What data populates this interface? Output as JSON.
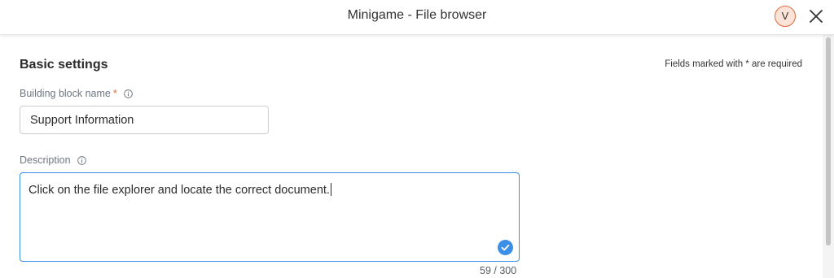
{
  "header": {
    "title": "Minigame - File browser",
    "avatar_initial": "V",
    "close_icon": "close-icon",
    "avatar_border_color": "#e0693d"
  },
  "section": {
    "title": "Basic settings",
    "required_note": "Fields marked with * are required"
  },
  "fields": {
    "name": {
      "label": "Building block name",
      "required_mark": "*",
      "info_icon": "info-icon",
      "value": "Support Information"
    },
    "description": {
      "label": "Description",
      "info_icon": "info-icon",
      "value": "Click on the file explorer and locate the correct document.",
      "char_count": "59 / 300",
      "status_icon": "check-icon",
      "focus_color": "#3b8fe6"
    }
  }
}
